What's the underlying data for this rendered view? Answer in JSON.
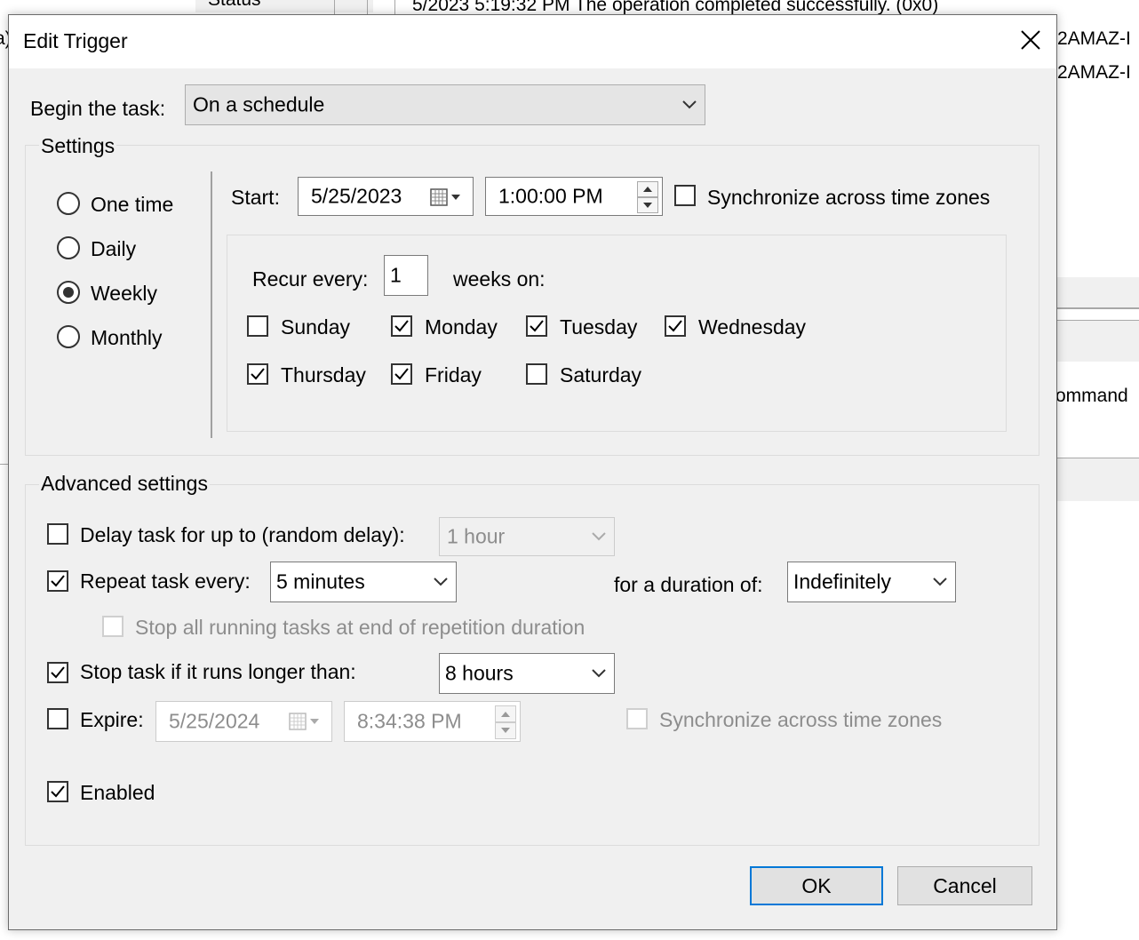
{
  "background": {
    "status_header": "Status",
    "log_row": "5/2023 5:19:32 PM   The operation completed successfully. (0x0)",
    "host_1": "2AMAZ-I",
    "host_2": "2AMAZ-I",
    "command_partial": "ommand",
    "left_edge_char": "a)"
  },
  "dialog": {
    "title": "Edit Trigger",
    "begin": {
      "label": "Begin the task:",
      "value": "On a schedule"
    },
    "settings": {
      "legend": "Settings",
      "schedule_options": [
        {
          "label": "One time",
          "selected": false
        },
        {
          "label": "Daily",
          "selected": false
        },
        {
          "label": "Weekly",
          "selected": true
        },
        {
          "label": "Monthly",
          "selected": false
        }
      ],
      "start_label": "Start:",
      "start_date": "5/25/2023",
      "start_time": "1:00:00 PM",
      "sync_label": "Synchronize across time zones",
      "sync_checked": false,
      "recur_label": "Recur every:",
      "recur_value": "1",
      "weeks_on_label": "weeks on:",
      "days": [
        {
          "label": "Sunday",
          "checked": false
        },
        {
          "label": "Monday",
          "checked": true
        },
        {
          "label": "Tuesday",
          "checked": true
        },
        {
          "label": "Wednesday",
          "checked": true
        },
        {
          "label": "Thursday",
          "checked": true
        },
        {
          "label": "Friday",
          "checked": true
        },
        {
          "label": "Saturday",
          "checked": false
        }
      ]
    },
    "advanced": {
      "legend": "Advanced settings",
      "delay_label": "Delay task for up to (random delay):",
      "delay_checked": false,
      "delay_value": "1 hour",
      "repeat_label": "Repeat task every:",
      "repeat_checked": true,
      "repeat_value": "5 minutes",
      "duration_label": "for a duration of:",
      "duration_value": "Indefinitely",
      "stop_all_label": "Stop all running tasks at end of repetition duration",
      "stop_all_checked": false,
      "stop_longer_label": "Stop task if it runs longer than:",
      "stop_longer_checked": true,
      "stop_longer_value": "8 hours",
      "expire_label": "Expire:",
      "expire_checked": false,
      "expire_date": "5/25/2024",
      "expire_time": "8:34:38 PM",
      "expire_sync_label": "Synchronize across time zones",
      "expire_sync_checked": false,
      "enabled_label": "Enabled",
      "enabled_checked": true
    },
    "buttons": {
      "ok": "OK",
      "cancel": "Cancel"
    }
  },
  "colors": {
    "dialog_bg": "#f0f0f0",
    "primary_border": "#0078d7",
    "disabled_text": "#8d8d8d"
  }
}
